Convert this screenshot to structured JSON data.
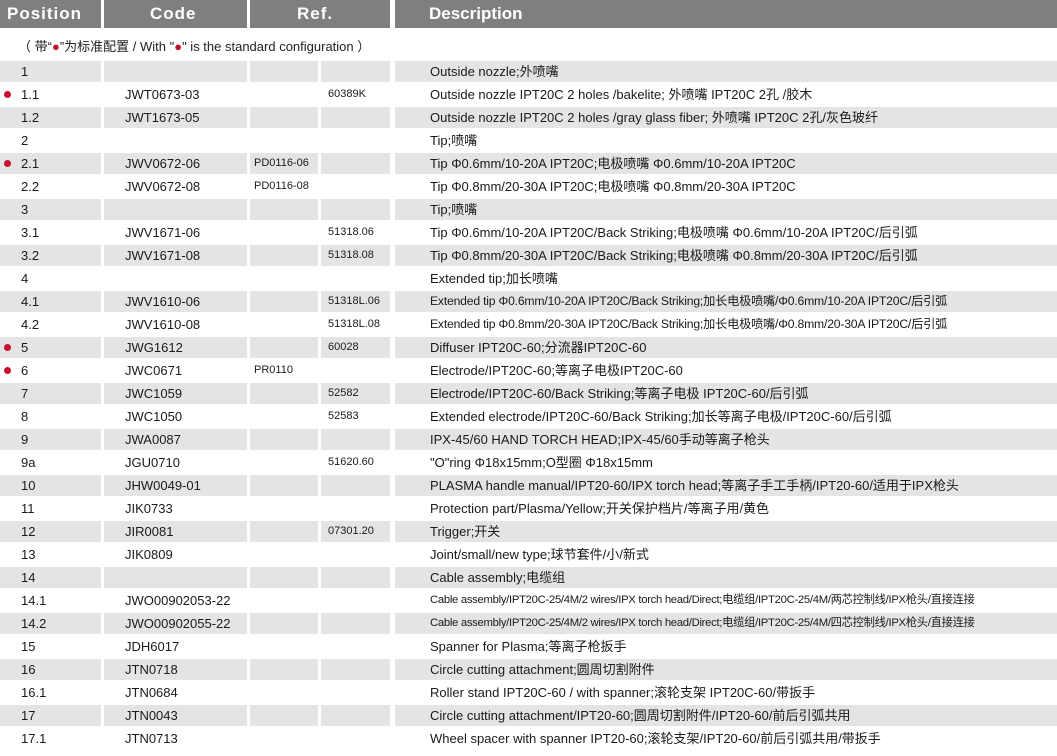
{
  "colors": {
    "header_bg": "#7f7f7f",
    "row_shade": "#e4e4e5",
    "bullet": "#c8102e"
  },
  "header": {
    "position": "Position",
    "code": "Code",
    "ref": "Ref.",
    "description": "Description"
  },
  "note": {
    "prefix": "（ 带“",
    "dot": "●",
    "mid": "”为标准配置 / With \"",
    "dot2": "●",
    "suffix": "\" is the standard configuration ）"
  },
  "rows": [
    {
      "pos": "1",
      "code": "",
      "ref1": "",
      "ref2": "",
      "desc": "Outside nozzle;外喷嘴",
      "std": false
    },
    {
      "pos": "1.1",
      "code": "JWT0673-03",
      "ref1": "",
      "ref2": "60389K",
      "desc": "Outside nozzle IPT20C 2 holes /bakelite; 外喷嘴 IPT20C 2孔 /胶木",
      "std": true
    },
    {
      "pos": "1.2",
      "code": "JWT1673-05",
      "ref1": "",
      "ref2": "",
      "desc": "Outside nozzle IPT20C 2 holes /gray glass fiber; 外喷嘴  IPT20C 2孔/灰色玻纤",
      "std": false
    },
    {
      "pos": "2",
      "code": "",
      "ref1": "",
      "ref2": "",
      "desc": "Tip;喷嘴",
      "std": false
    },
    {
      "pos": "2.1",
      "code": "JWV0672-06",
      "ref1": "PD0116-06",
      "ref2": "",
      "desc": "Tip  Φ0.6mm/10-20A IPT20C;电极喷嘴  Φ0.6mm/10-20A IPT20C",
      "std": true
    },
    {
      "pos": "2.2",
      "code": "JWV0672-08",
      "ref1": "PD0116-08",
      "ref2": "",
      "desc": "Tip  Φ0.8mm/20-30A IPT20C;电极喷嘴  Φ0.8mm/20-30A IPT20C",
      "std": false
    },
    {
      "pos": "3",
      "code": "",
      "ref1": "",
      "ref2": "",
      "desc": "Tip;喷嘴",
      "std": false
    },
    {
      "pos": "3.1",
      "code": "JWV1671-06",
      "ref1": "",
      "ref2": "51318.06",
      "desc": "Tip  Φ0.6mm/10-20A IPT20C/Back Striking;电极喷嘴  Φ0.6mm/10-20A  IPT20C/后引弧",
      "std": false
    },
    {
      "pos": "3.2",
      "code": "JWV1671-08",
      "ref1": "",
      "ref2": "51318.08",
      "desc": "Tip  Φ0.8mm/20-30A IPT20C/Back Striking;电极喷嘴  Φ0.8mm/20-30A  IPT20C/后引弧",
      "std": false
    },
    {
      "pos": "4",
      "code": "",
      "ref1": "",
      "ref2": "",
      "desc": "Extended tip;加长喷嘴",
      "std": false
    },
    {
      "pos": "4.1",
      "code": "JWV1610-06",
      "ref1": "",
      "ref2": "51318L.06",
      "desc": "Extended tip  Φ0.6mm/10-20A IPT20C/Back Striking;加长电极喷嘴/Φ0.6mm/10-20A IPT20C/后引弧",
      "std": false,
      "fit": "tight"
    },
    {
      "pos": "4.2",
      "code": "JWV1610-08",
      "ref1": "",
      "ref2": "51318L.08",
      "desc": "Extended tip  Φ0.8mm/20-30A IPT20C/Back Striking;加长电极喷嘴/Φ0.8mm/20-30A IPT20C/后引弧",
      "std": false,
      "fit": "tight"
    },
    {
      "pos": "5",
      "code": "JWG1612",
      "ref1": "",
      "ref2": "60028",
      "desc": "Diffuser IPT20C-60;分流器IPT20C-60",
      "std": true
    },
    {
      "pos": "6",
      "code": "JWC0671",
      "ref1": "PR0110",
      "ref2": "",
      "desc": "Electrode/IPT20C-60;等离子电极IPT20C-60",
      "std": true
    },
    {
      "pos": "7",
      "code": "JWC1059",
      "ref1": "",
      "ref2": "52582",
      "desc": "Electrode/IPT20C-60/Back Striking;等离子电极 IPT20C-60/后引弧",
      "std": false
    },
    {
      "pos": "8",
      "code": "JWC1050",
      "ref1": "",
      "ref2": "52583",
      "desc": "Extended electrode/IPT20C-60/Back Striking;加长等离子电极/IPT20C-60/后引弧",
      "std": false
    },
    {
      "pos": "9",
      "code": "JWA0087",
      "ref1": "",
      "ref2": "",
      "desc": "IPX-45/60 HAND TORCH HEAD;IPX-45/60手动等离子枪头",
      "std": false
    },
    {
      "pos": "9a",
      "code": "JGU0710",
      "ref1": "",
      "ref2": "51620.60",
      "desc": "\"O\"ring Φ18x15mm;O型圈 Φ18x15mm",
      "std": false
    },
    {
      "pos": "10",
      "code": "JHW0049-01",
      "ref1": "",
      "ref2": "",
      "desc": "PLASMA handle manual/IPT20-60/IPX torch head;等离子手工手柄/IPT20-60/适用于IPX枪头",
      "std": false
    },
    {
      "pos": "11",
      "code": "JIK0733",
      "ref1": "",
      "ref2": "",
      "desc": "Protection part/Plasma/Yellow;开关保护档片/等离子用/黄色",
      "std": false
    },
    {
      "pos": "12",
      "code": "JIR0081",
      "ref1": "",
      "ref2": "07301.20",
      "desc": "Trigger;开关",
      "std": false
    },
    {
      "pos": "13",
      "code": "JIK0809",
      "ref1": "",
      "ref2": "",
      "desc": "Joint/small/new type;球节套件/小/新式",
      "std": false
    },
    {
      "pos": "14",
      "code": "",
      "ref1": "",
      "ref2": "",
      "desc": "Cable assembly;电缆组",
      "std": false
    },
    {
      "pos": "14.1",
      "code": "JWO00902053-22",
      "ref1": "",
      "ref2": "",
      "desc": "Cable assembly/IPT20C-25/4M/2 wires/IPX torch head/Direct;电缆组/IPT20C-25/4M/两芯控制线/IPX枪头/直接连接",
      "std": false,
      "fit": "small"
    },
    {
      "pos": "14.2",
      "code": "JWO00902055-22",
      "ref1": "",
      "ref2": "",
      "desc": "Cable assembly/IPT20C-25/4M/2 wires/IPX torch head/Direct;电缆组/IPT20C-25/4M/四芯控制线/IPX枪头/直接连接",
      "std": false,
      "fit": "small"
    },
    {
      "pos": "15",
      "code": "JDH6017",
      "ref1": "",
      "ref2": "",
      "desc": "Spanner for Plasma;等离子枪扳手",
      "std": false
    },
    {
      "pos": "16",
      "code": "JTN0718",
      "ref1": "",
      "ref2": "",
      "desc": "Circle cutting attachment;圆周切割附件",
      "std": false
    },
    {
      "pos": "16.1",
      "code": "JTN0684",
      "ref1": "",
      "ref2": "",
      "desc": "Roller stand IPT20C-60 / with spanner;滚轮支架 IPT20C-60/带扳手",
      "std": false
    },
    {
      "pos": "17",
      "code": "JTN0043",
      "ref1": "",
      "ref2": "",
      "desc": "Circle cutting attachment/IPT20-60;圆周切割附件/IPT20-60/前后引弧共用",
      "std": false
    },
    {
      "pos": "17.1",
      "code": "JTN0713",
      "ref1": "",
      "ref2": "",
      "desc": "Wheel spacer with spanner IPT20-60;滚轮支架/IPT20-60/前后引弧共用/带扳手",
      "std": false
    }
  ]
}
